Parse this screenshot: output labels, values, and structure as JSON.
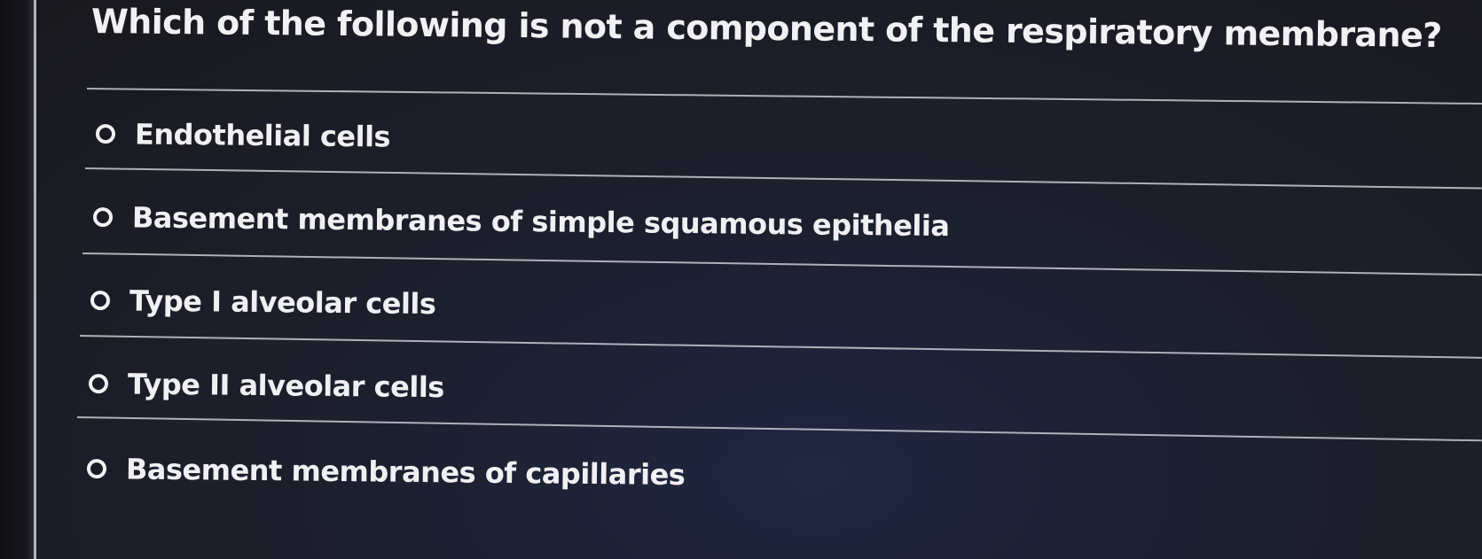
{
  "question": {
    "text": "Which of the following is not a component of the respiratory membrane?"
  },
  "options": [
    {
      "label": "Endothelial cells",
      "selected": false
    },
    {
      "label": "Basement membranes of simple squamous epithelia",
      "selected": false
    },
    {
      "label": "Type I alveolar cells",
      "selected": false
    },
    {
      "label": "Type II alveolar cells",
      "selected": false
    },
    {
      "label": "Basement membranes of capillaries",
      "selected": false
    }
  ]
}
